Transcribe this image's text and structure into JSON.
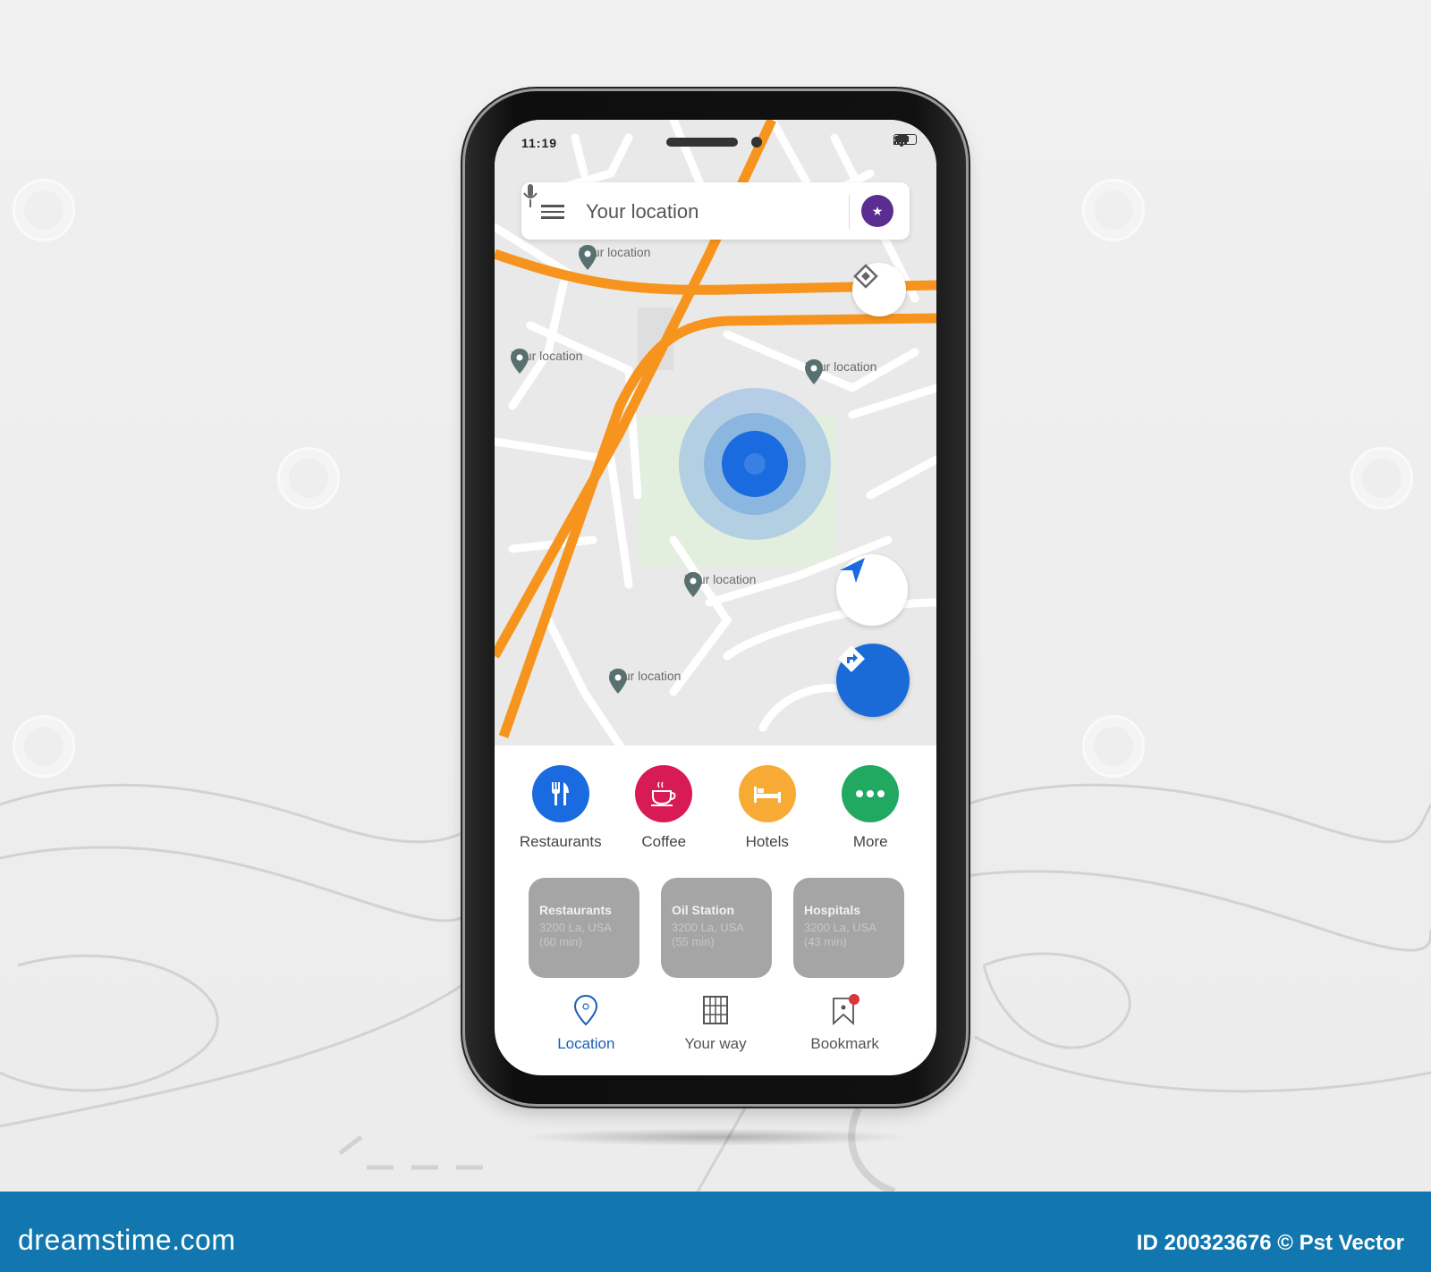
{
  "status_bar": {
    "time": "11:19"
  },
  "search": {
    "placeholder": "Your location"
  },
  "avatar": {
    "glyph": "★",
    "color": "#5a2d91"
  },
  "map": {
    "pins": [
      {
        "label": "Your location"
      },
      {
        "label": "Your location"
      },
      {
        "label": "Your location"
      },
      {
        "label": "Your location"
      },
      {
        "label": "Your location"
      }
    ],
    "road_color": "#f7941d",
    "current_location_color": "#1a6be0"
  },
  "fabs": {
    "layers": "layers-icon",
    "navigate": "navigate-arrow-icon",
    "directions": "directions-icon"
  },
  "categories": [
    {
      "label": "Restaurants",
      "icon": "restaurant-icon",
      "color": "#1a6be0"
    },
    {
      "label": "Coffee",
      "icon": "coffee-icon",
      "color": "#d81b55"
    },
    {
      "label": "Hotels",
      "icon": "hotel-icon",
      "color": "#f7ab35"
    },
    {
      "label": "More",
      "icon": "more-icon",
      "color": "#21a861"
    }
  ],
  "cards": [
    {
      "title": "Restaurants",
      "address": "3200 La, USA",
      "eta": "(60 min)"
    },
    {
      "title": "Oil Station",
      "address": "3200 La, USA",
      "eta": "(55 min)"
    },
    {
      "title": "Hospitals",
      "address": "3200 La, USA",
      "eta": "(43 min)"
    }
  ],
  "tabbar": [
    {
      "label": "Location",
      "icon": "location-pin-icon",
      "active": true
    },
    {
      "label": "Your way",
      "icon": "grid-map-icon",
      "active": false
    },
    {
      "label": "Bookmark",
      "icon": "bookmark-icon",
      "active": false
    }
  ],
  "footer": {
    "brand": "dreamstime.com",
    "credit": "ID 200323676 © Pst Vector"
  }
}
